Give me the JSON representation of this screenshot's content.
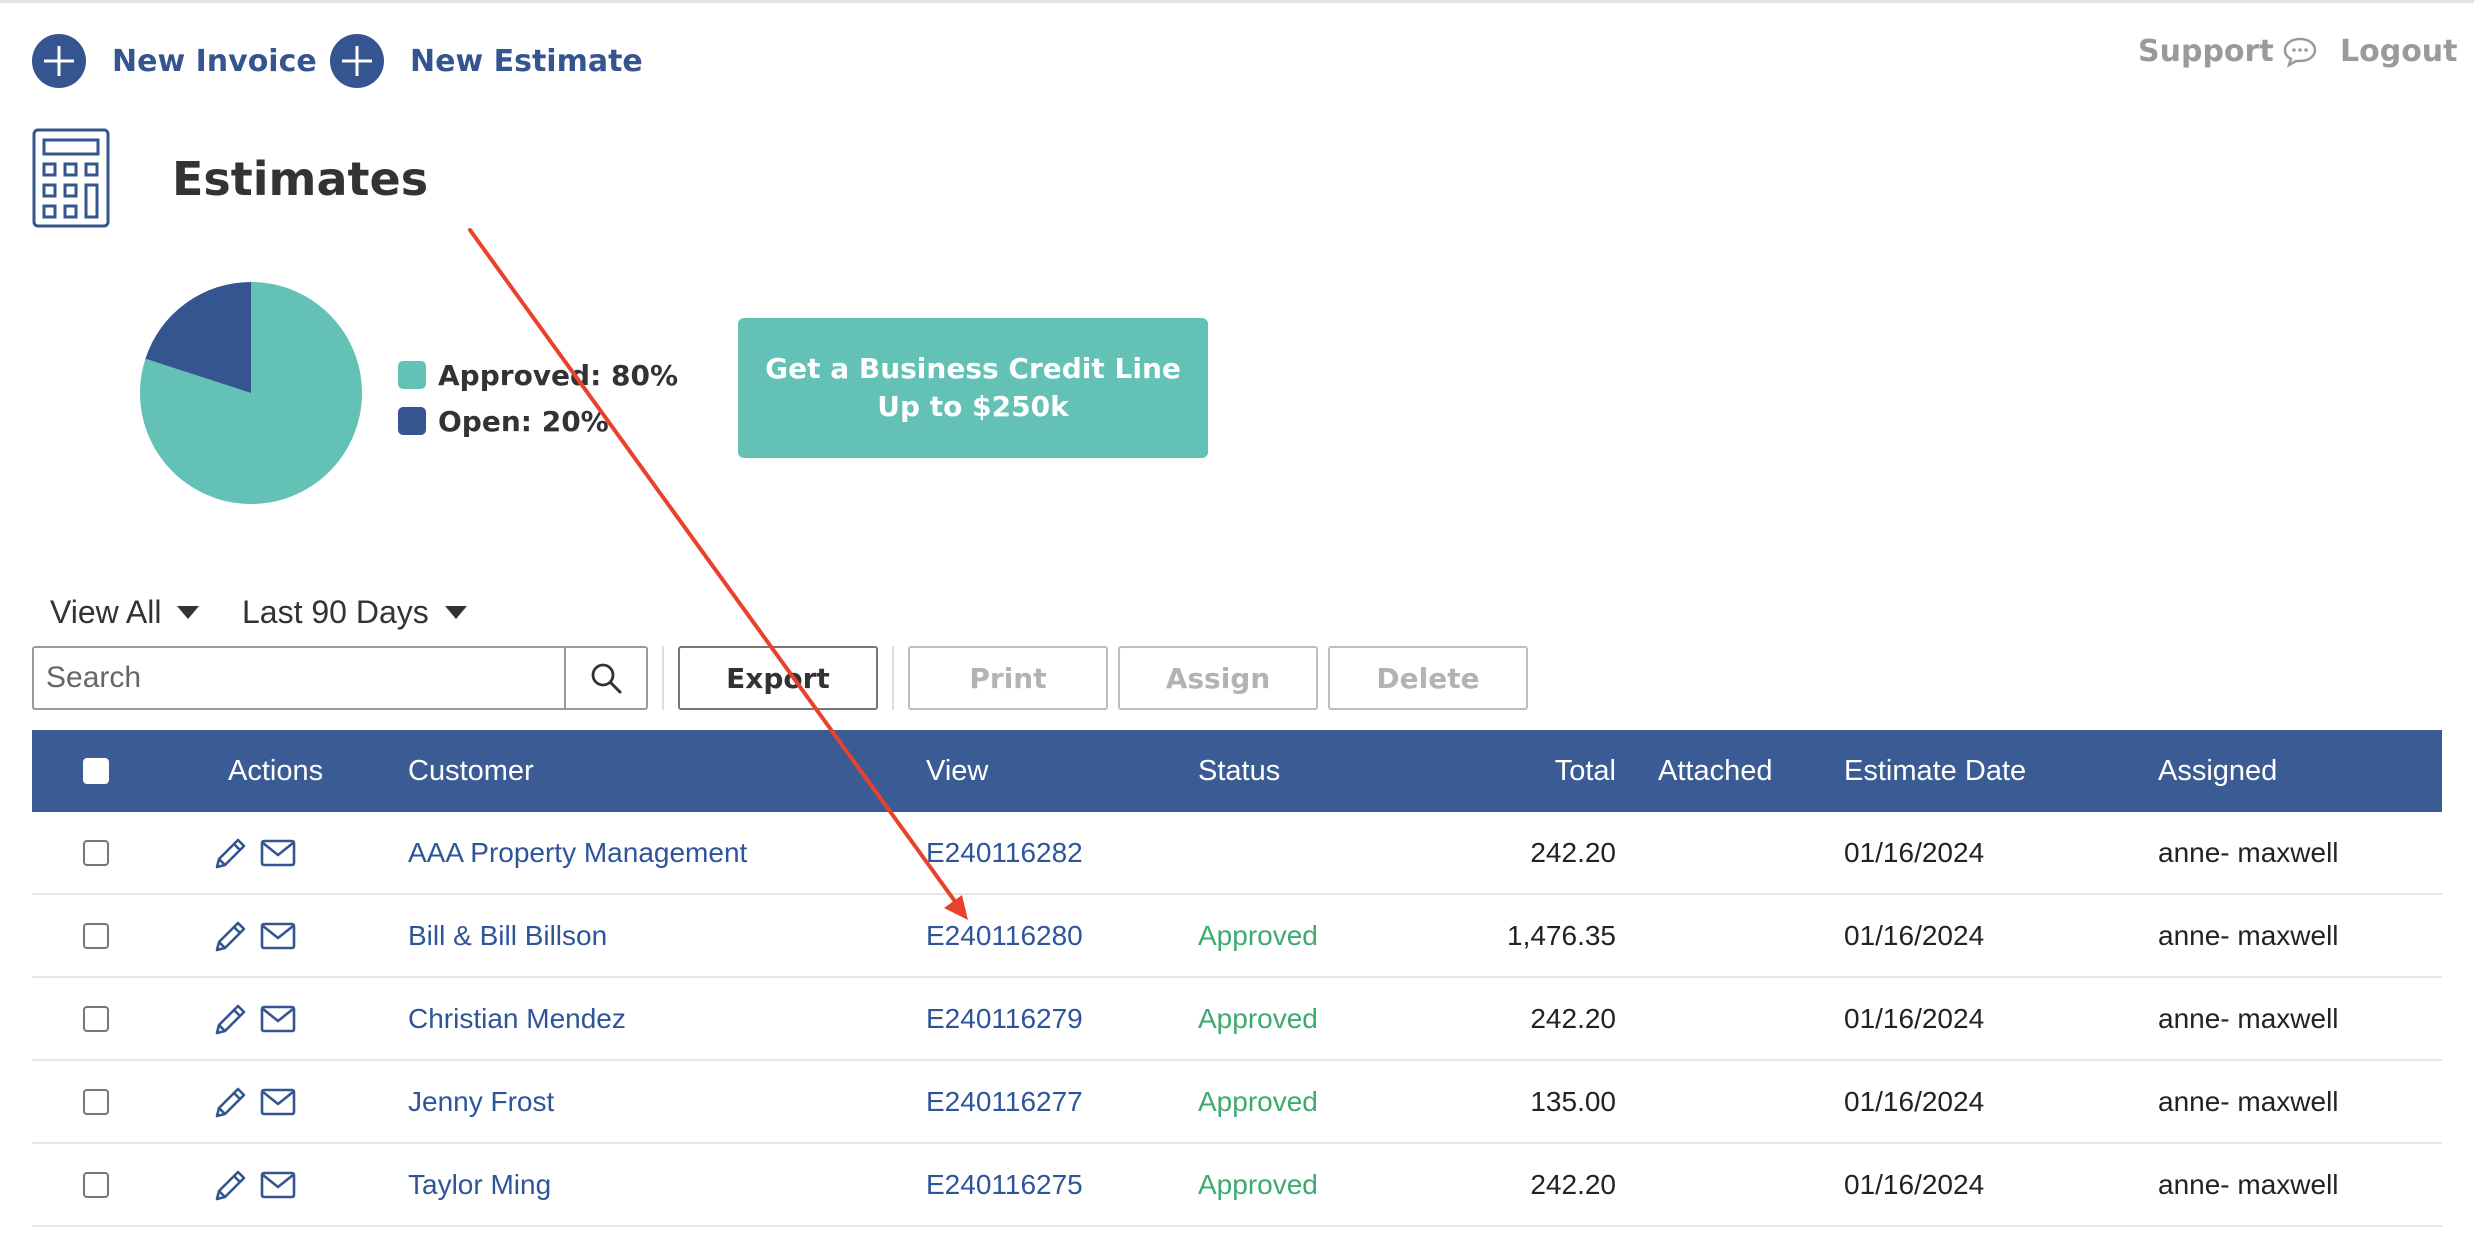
{
  "topnav": {
    "new_invoice": "New Invoice",
    "new_estimate": "New Estimate",
    "support": "Support",
    "logout": "Logout"
  },
  "page": {
    "title": "Estimates"
  },
  "chart_data": {
    "type": "pie",
    "title": "",
    "slices": [
      {
        "label": "Approved",
        "value": 80,
        "color": "#63c1b6"
      },
      {
        "label": "Open",
        "value": 20,
        "color": "#34558f"
      }
    ],
    "legend_labels": [
      "Approved: 80%",
      "Open: 20%"
    ],
    "legend_position": "right"
  },
  "promo": {
    "line1": "Get a Business Credit Line",
    "line2": "Up to $250k"
  },
  "filters": {
    "view": "View All",
    "range": "Last 90 Days"
  },
  "toolbar": {
    "search_placeholder": "Search",
    "export": "Export",
    "print": "Print",
    "assign": "Assign",
    "delete": "Delete"
  },
  "table": {
    "headers": {
      "actions": "Actions",
      "customer": "Customer",
      "view": "View",
      "status": "Status",
      "total": "Total",
      "attached": "Attached",
      "estimate_date": "Estimate Date",
      "assigned": "Assigned"
    },
    "rows": [
      {
        "customer": "AAA Property Management",
        "view": "E240116282",
        "status": "",
        "total": "242.20",
        "attached": "",
        "date": "01/16/2024",
        "assigned": "anne- maxwell"
      },
      {
        "customer": "Bill & Bill Billson",
        "view": "E240116280",
        "status": "Approved",
        "total": "1,476.35",
        "attached": "",
        "date": "01/16/2024",
        "assigned": "anne- maxwell"
      },
      {
        "customer": "Christian Mendez",
        "view": "E240116279",
        "status": "Approved",
        "total": "242.20",
        "attached": "",
        "date": "01/16/2024",
        "assigned": "anne- maxwell"
      },
      {
        "customer": "Jenny Frost",
        "view": "E240116277",
        "status": "Approved",
        "total": "135.00",
        "attached": "",
        "date": "01/16/2024",
        "assigned": "anne- maxwell"
      },
      {
        "customer": "Taylor Ming",
        "view": "E240116275",
        "status": "Approved",
        "total": "242.20",
        "attached": "",
        "date": "01/16/2024",
        "assigned": "anne- maxwell"
      }
    ]
  },
  "colors": {
    "brand": "#34558f",
    "header_bg": "#3a5b94",
    "accent_teal": "#63c1b6",
    "status_approved": "#3daa6f",
    "annotation_arrow": "#e8422c"
  },
  "icons": [
    "plus-circle-icon",
    "chat-bubble-icon",
    "calculator-icon",
    "search-icon",
    "pencil-icon",
    "envelope-icon",
    "caret-down-icon"
  ]
}
